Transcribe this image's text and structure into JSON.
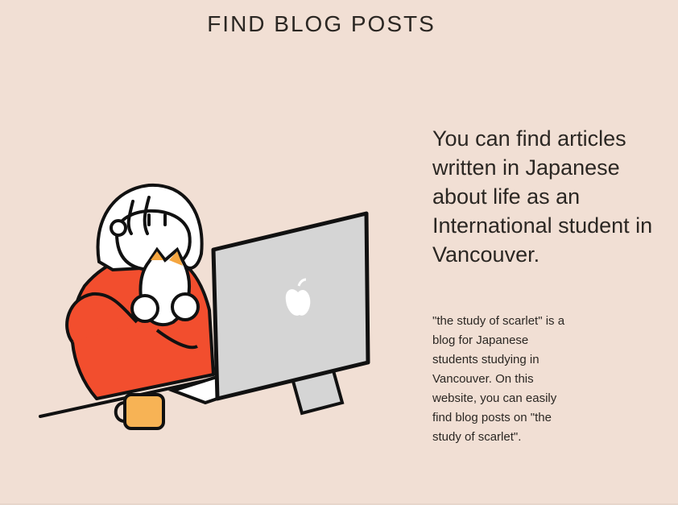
{
  "header": {
    "title": "FIND BLOG POSTS"
  },
  "hero": {
    "headline": "You can find articles written in Japanese about life as an International student in Vancouver.",
    "description": "\"the study of scarlet\" is a blog for Japanese students studying in Vancouver. On this website, you can easily find blog posts on \"the study of scarlet\".",
    "illustration": {
      "icon": "woman-with-cat-at-computer-illustration",
      "colors": {
        "background": "#f1dfd4",
        "sweater": "#f24e2e",
        "cat_orange": "#f5a640",
        "mug": "#f7b355",
        "monitor": "#d5d5d5",
        "outline": "#111111"
      }
    }
  }
}
